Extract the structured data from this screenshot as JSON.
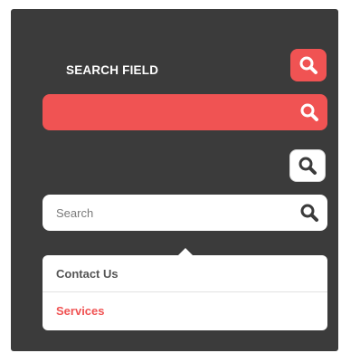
{
  "header": {
    "title": "SEARCH FIELD"
  },
  "search_field": {
    "placeholder": "Search"
  },
  "dropdown": {
    "items": [
      {
        "label": "Contact Us"
      },
      {
        "label": "Services"
      }
    ]
  },
  "icons": {
    "primary": "search-icon",
    "magnifier": "magnifier-icon"
  },
  "colors": {
    "panel_bg": "#3b3b3b",
    "accent": "#f05353",
    "surface": "#ffffff",
    "text_dark": "#555555",
    "link_active": "#f05353"
  }
}
